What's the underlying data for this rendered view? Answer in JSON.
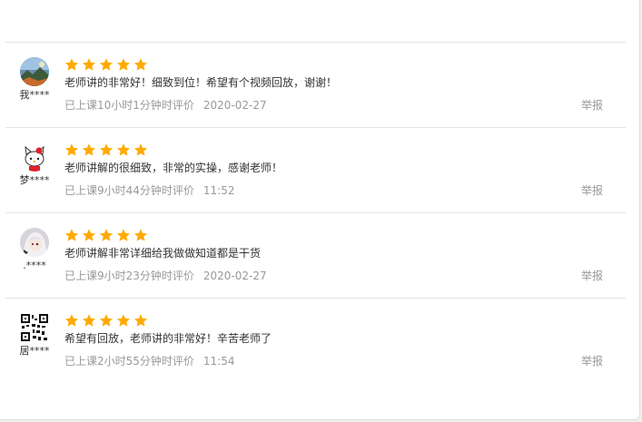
{
  "reviews": [
    {
      "username": "我****",
      "avatar": "landscape-avatar",
      "rating": 5,
      "comment": "老师讲的非常好！细致到位！希望有个视频回放，谢谢！",
      "study_time": "已上课10小时1分钟时评价",
      "date": "2020-02-27",
      "report_label": "举报"
    },
    {
      "username": "梦****",
      "avatar": "cartoon-cat-avatar",
      "rating": 5,
      "comment": "老师讲解的很细致，非常的实操，感谢老师！",
      "study_time": "已上课9小时44分钟时评价",
      "date": "11:52",
      "report_label": "举报"
    },
    {
      "username": ".****",
      "avatar": "anime-girl-avatar",
      "rating": 5,
      "comment": "老师讲解非常详细给我做做知道都是干货",
      "study_time": "已上课9小时23分钟时评价",
      "date": "2020-02-27",
      "report_label": "举报"
    },
    {
      "username": "居****",
      "avatar": "qr-code-avatar",
      "rating": 5,
      "comment": "希望有回放，老师讲的非常好！辛苦老师了",
      "study_time": "已上课2小时55分钟时评价",
      "date": "11:54",
      "report_label": "举报"
    }
  ],
  "colors": {
    "star": "#ffaa00",
    "text": "#333333",
    "muted": "#999999",
    "divider": "#e4e4e4"
  }
}
